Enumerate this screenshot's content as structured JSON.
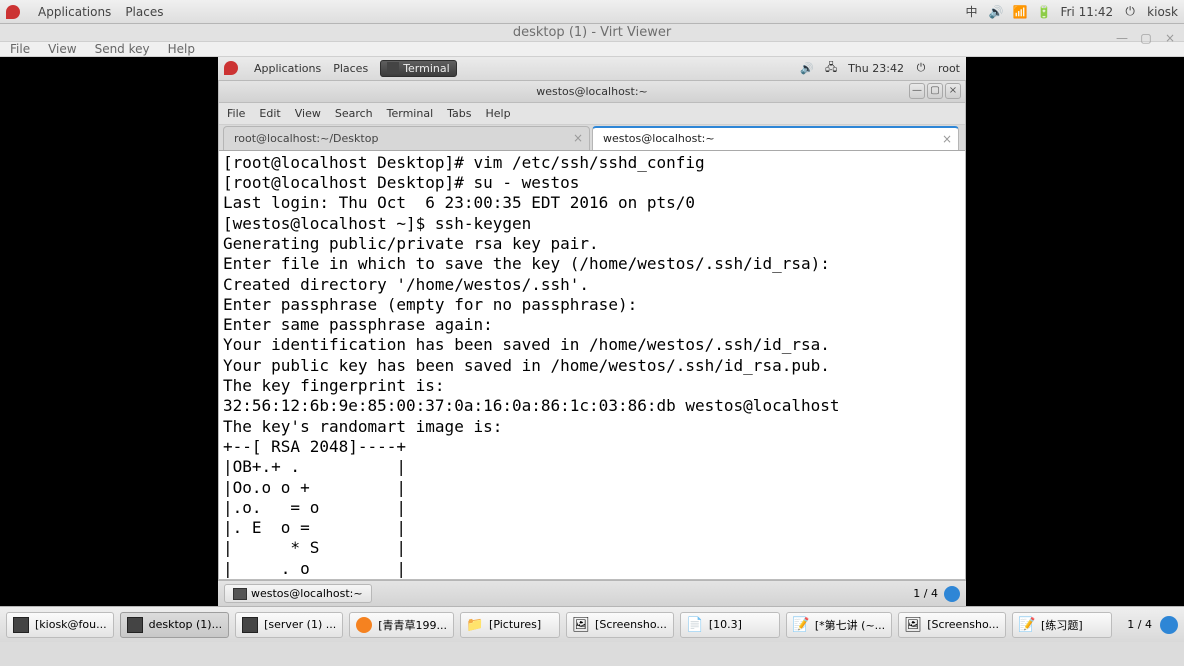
{
  "outer_top": {
    "applications": "Applications",
    "places": "Places",
    "clock": "Fri 11:42",
    "user": "kiosk",
    "icons": {
      "ime": "中",
      "volume": "🔊",
      "wifi": "📶",
      "battery": "🔋",
      "power": "⏻"
    }
  },
  "virt": {
    "title": "desktop (1) - Virt Viewer",
    "menu": {
      "file": "File",
      "view": "View",
      "sendkey": "Send key",
      "help": "Help"
    },
    "winbtn": {
      "min": "—",
      "max": "▢",
      "close": "×"
    }
  },
  "inner_top": {
    "applications": "Applications",
    "places": "Places",
    "task": "Terminal",
    "clock": "Thu 23:42",
    "user": "root",
    "icons": {
      "volume": "🔊",
      "net": "🖧",
      "power": "⏻"
    }
  },
  "termwin": {
    "title": "westos@localhost:~",
    "menu": {
      "file": "File",
      "edit": "Edit",
      "view": "View",
      "search": "Search",
      "terminal": "Terminal",
      "tabs": "Tabs",
      "help": "Help"
    },
    "tabs": [
      {
        "label": "root@localhost:~/Desktop",
        "active": false
      },
      {
        "label": "westos@localhost:~",
        "active": true
      }
    ],
    "winbtn": {
      "min": "—",
      "max": "▢",
      "close": "×"
    }
  },
  "terminal_lines": [
    "[root@localhost Desktop]# vim /etc/ssh/sshd_config",
    "[root@localhost Desktop]# su - westos",
    "Last login: Thu Oct  6 23:00:35 EDT 2016 on pts/0",
    "[westos@localhost ~]$ ssh-keygen",
    "Generating public/private rsa key pair.",
    "Enter file in which to save the key (/home/westos/.ssh/id_rsa):",
    "Created directory '/home/westos/.ssh'.",
    "Enter passphrase (empty for no passphrase):",
    "Enter same passphrase again:",
    "Your identification has been saved in /home/westos/.ssh/id_rsa.",
    "Your public key has been saved in /home/westos/.ssh/id_rsa.pub.",
    "The key fingerprint is:",
    "32:56:12:6b:9e:85:00:37:0a:16:0a:86:1c:03:86:db westos@localhost",
    "The key's randomart image is:",
    "+--[ RSA 2048]----+",
    "|OB+.+ .          |",
    "|Oo.o o +         |",
    "|.o.   = o        |",
    "|. E  o =         |",
    "|      * S        |",
    "|     . o         |"
  ],
  "inner_bottom": {
    "task": "westos@localhost:~",
    "workspace": "1 / 4"
  },
  "outer_bottom": {
    "tasks": [
      {
        "icon": "term",
        "label": "[kiosk@fou..."
      },
      {
        "icon": "term",
        "label": "desktop (1)...",
        "active": true
      },
      {
        "icon": "term",
        "label": "[server (1) ..."
      },
      {
        "icon": "fx",
        "label": "[青青草199..."
      },
      {
        "icon": "folder",
        "label": "[Pictures]"
      },
      {
        "icon": "img",
        "label": "[Screensho..."
      },
      {
        "icon": "doc",
        "label": "[10.3]"
      },
      {
        "icon": "gedit",
        "label": "[*第七讲 (~..."
      },
      {
        "icon": "img",
        "label": "[Screensho..."
      },
      {
        "icon": "gedit",
        "label": "[练习题]"
      }
    ],
    "workspace": "1 / 4"
  }
}
